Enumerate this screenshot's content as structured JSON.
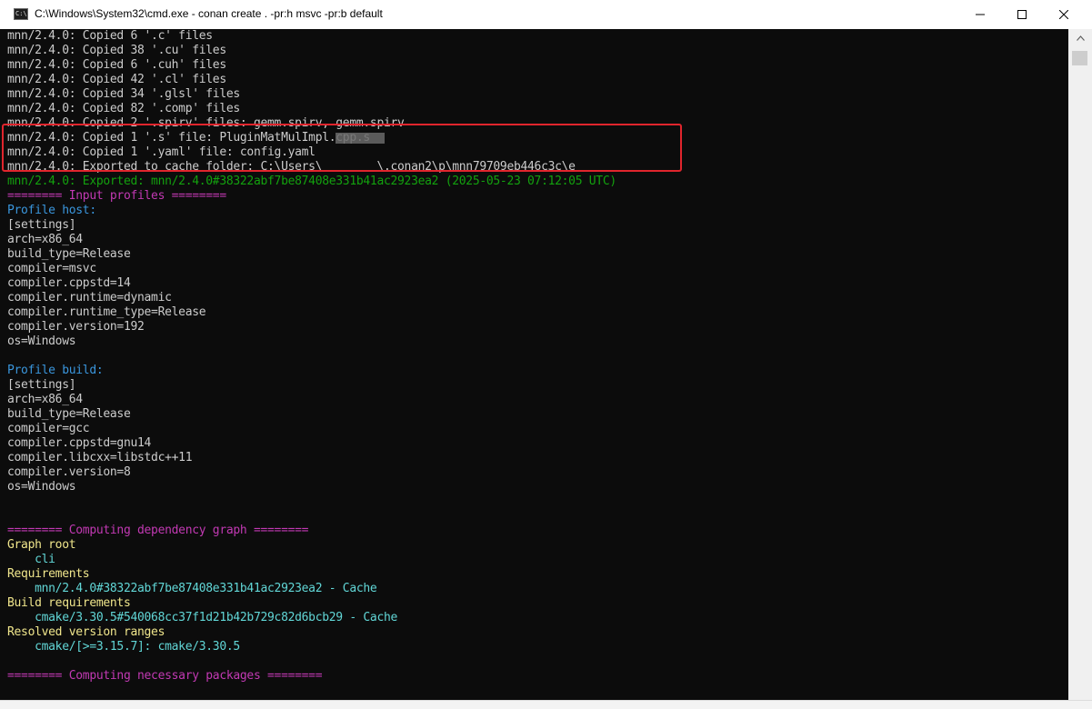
{
  "window": {
    "title": "C:\\Windows\\System32\\cmd.exe - conan  create . -pr:h msvc -pr:b default",
    "icon_label": "C:\\"
  },
  "controls": {
    "minimize_icon": "minimize-icon",
    "maximize_icon": "maximize-icon",
    "close_icon": "close-icon"
  },
  "colors": {
    "background": "#0c0c0c",
    "default_text": "#cccccc",
    "green": "#13a10e",
    "magenta": "#c239b3",
    "cyan": "#3a96dd",
    "yellow": "#f0e68c",
    "highlight_border": "#e0252d"
  },
  "console": {
    "lines": [
      {
        "text": "mnn/2.4.0: Copied 6 '.c' files",
        "color": "white"
      },
      {
        "text": "mnn/2.4.0: Copied 38 '.cu' files",
        "color": "white"
      },
      {
        "text": "mnn/2.4.0: Copied 6 '.cuh' files",
        "color": "white"
      },
      {
        "text": "mnn/2.4.0: Copied 42 '.cl' files",
        "color": "white"
      },
      {
        "text": "mnn/2.4.0: Copied 34 '.glsl' files",
        "color": "white"
      },
      {
        "text": "mnn/2.4.0: Copied 82 '.comp' files",
        "color": "white"
      },
      {
        "text": "mnn/2.4.0: Copied 2 '.spirv' files: gemm.spirv, gemm.spirv",
        "color": "white"
      },
      {
        "text": "mnn/2.4.0: Copied 1 '.s' file: PluginMatMulImpl.cpp.s",
        "color": "white"
      },
      {
        "text": "mnn/2.4.0: Copied 1 '.yaml' file: config.yaml",
        "color": "white"
      },
      {
        "text": "mnn/2.4.0: Exported to cache folder: C:\\Users\\        \\.conan2\\p\\mnn79709eb446c3c\\e",
        "color": "white"
      },
      {
        "text": "mnn/2.4.0: Exported: mnn/2.4.0#38322abf7be87408e331b41ac2923ea2 (2025-05-23 07:12:05 UTC)",
        "color": "green"
      },
      {
        "text": "======== Input profiles ========",
        "color": "magenta"
      },
      {
        "text": "Profile host:",
        "color": "cyan"
      },
      {
        "text": "[settings]",
        "color": "white"
      },
      {
        "text": "arch=x86_64",
        "color": "white"
      },
      {
        "text": "build_type=Release",
        "color": "white"
      },
      {
        "text": "compiler=msvc",
        "color": "white"
      },
      {
        "text": "compiler.cppstd=14",
        "color": "white"
      },
      {
        "text": "compiler.runtime=dynamic",
        "color": "white"
      },
      {
        "text": "compiler.runtime_type=Release",
        "color": "white"
      },
      {
        "text": "compiler.version=192",
        "color": "white"
      },
      {
        "text": "os=Windows",
        "color": "white"
      },
      {
        "text": "",
        "color": "white"
      },
      {
        "text": "Profile build:",
        "color": "cyan"
      },
      {
        "text": "[settings]",
        "color": "white"
      },
      {
        "text": "arch=x86_64",
        "color": "white"
      },
      {
        "text": "build_type=Release",
        "color": "white"
      },
      {
        "text": "compiler=gcc",
        "color": "white"
      },
      {
        "text": "compiler.cppstd=gnu14",
        "color": "white"
      },
      {
        "text": "compiler.libcxx=libstdc++11",
        "color": "white"
      },
      {
        "text": "compiler.version=8",
        "color": "white"
      },
      {
        "text": "os=Windows",
        "color": "white"
      },
      {
        "text": "",
        "color": "white"
      },
      {
        "text": "",
        "color": "white"
      },
      {
        "text": "======== Computing dependency graph ========",
        "color": "magenta"
      },
      {
        "text": "Graph root",
        "color": "yellow"
      },
      {
        "text": "    cli",
        "color": "teal"
      },
      {
        "text": "Requirements",
        "color": "yellow"
      },
      {
        "text": "    mnn/2.4.0#38322abf7be87408e331b41ac2923ea2 - Cache",
        "color": "teal"
      },
      {
        "text": "Build requirements",
        "color": "yellow"
      },
      {
        "text": "    cmake/3.30.5#540068cc37f1d21b42b729c82d6bcb29 - Cache",
        "color": "teal"
      },
      {
        "text": "Resolved version ranges",
        "color": "yellow"
      },
      {
        "text": "    cmake/[>=3.15.7]: cmake/3.30.5",
        "color": "teal"
      },
      {
        "text": "",
        "color": "white"
      },
      {
        "text": "======== Computing necessary packages ========",
        "color": "magenta"
      }
    ]
  }
}
